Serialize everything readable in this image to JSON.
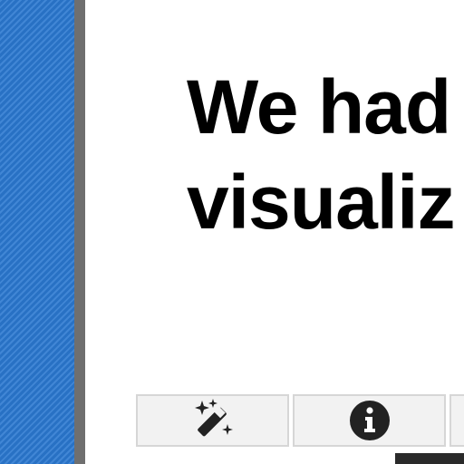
{
  "headline": {
    "line1": "We had",
    "line2": "visualiz"
  },
  "toolbar": {
    "buttons": [
      {
        "icon": "magic-wand-icon"
      },
      {
        "icon": "info-icon"
      },
      {
        "icon": ""
      }
    ]
  },
  "colors": {
    "left_strip": "#2b78d0",
    "divider": "#6f6f6f",
    "button_bg": "#f2f2f2",
    "icon": "#222222"
  }
}
